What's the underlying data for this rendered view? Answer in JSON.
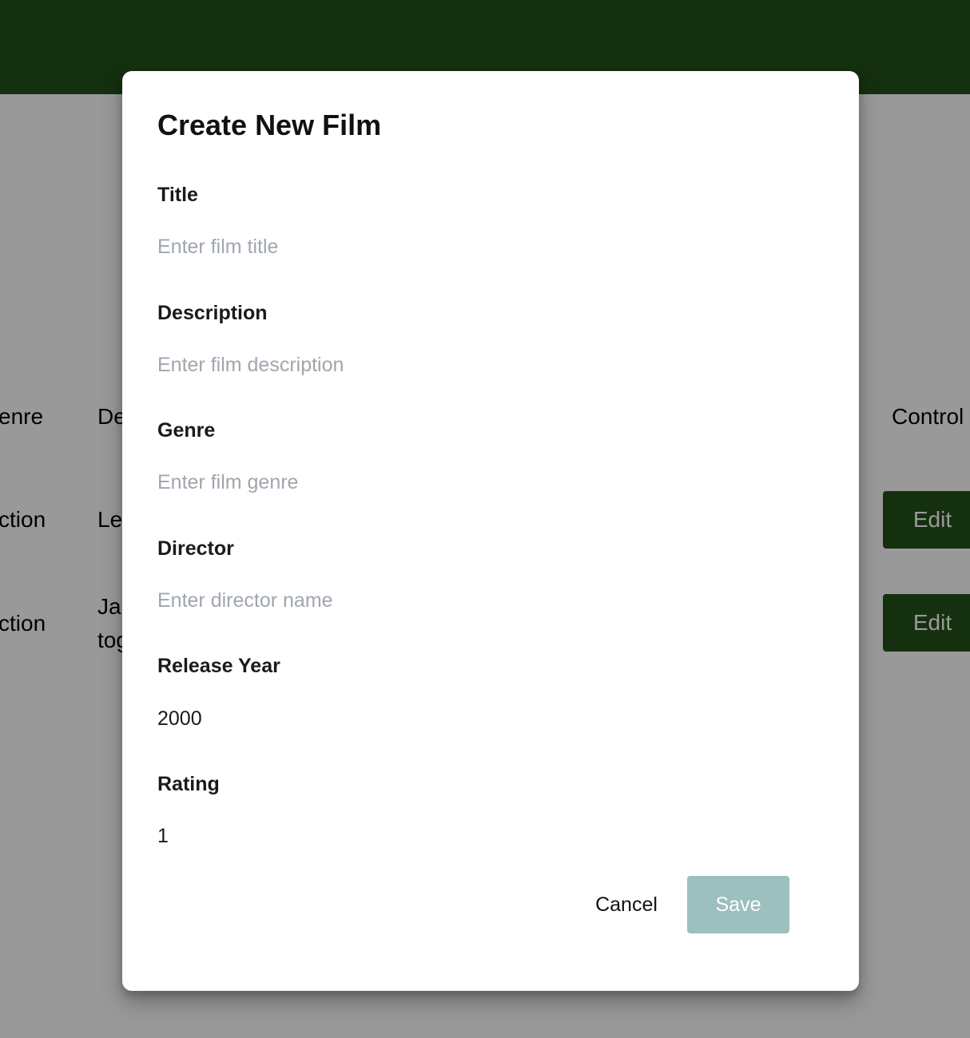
{
  "background": {
    "table": {
      "headers": {
        "genre": "enre",
        "description": "De",
        "controls": "Control"
      },
      "rows": [
        {
          "genre": "ction",
          "description": "Le",
          "edit_label": "Edit"
        },
        {
          "genre": "ction",
          "description_line1": "Ja",
          "description_line2": "tog",
          "edit_label": "Edit"
        }
      ]
    }
  },
  "modal": {
    "title": "Create New Film",
    "fields": {
      "title": {
        "label": "Title",
        "placeholder": "Enter film title",
        "value": ""
      },
      "description": {
        "label": "Description",
        "placeholder": "Enter film description",
        "value": ""
      },
      "genre": {
        "label": "Genre",
        "placeholder": "Enter film genre",
        "value": ""
      },
      "director": {
        "label": "Director",
        "placeholder": "Enter director name",
        "value": ""
      },
      "release_year": {
        "label": "Release Year",
        "value": "2000"
      },
      "rating": {
        "label": "Rating",
        "value": "1"
      }
    },
    "buttons": {
      "cancel_label": "Cancel",
      "save_label": "Save",
      "save_disabled": true
    }
  },
  "colors": {
    "header_green": "#245118",
    "save_disabled_bg": "#9cbfbf",
    "placeholder_gray": "#a0a6ae"
  }
}
